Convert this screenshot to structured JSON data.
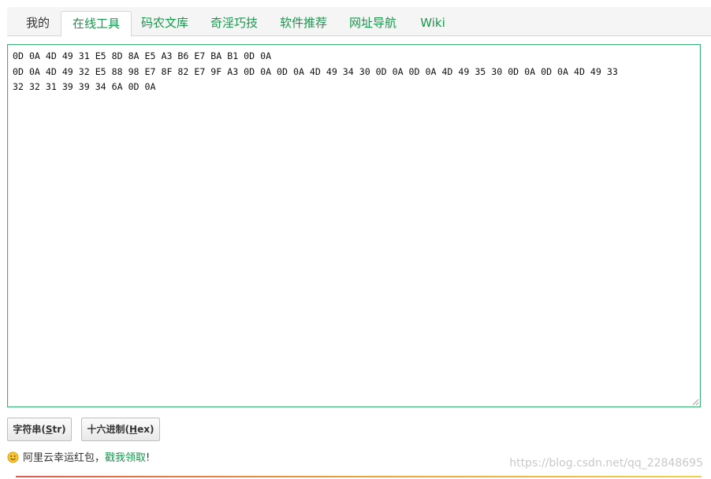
{
  "tabs": [
    {
      "label": "我的"
    },
    {
      "label": "在线工具"
    },
    {
      "label": "码农文库"
    },
    {
      "label": "奇淫巧技"
    },
    {
      "label": "软件推荐"
    },
    {
      "label": "网址导航"
    },
    {
      "label": "Wiki"
    }
  ],
  "active_tab": "在线工具",
  "editor": {
    "lines": [
      "0D 0A 4D 49 31 E5 8D 8A E5 A3 B6 E7 BA B1 0D 0A",
      "0D 0A 4D 49 32 E5 88 98 E7 8F 82 E7 9F A3 0D 0A 0D 0A 4D 49 34 30 0D 0A 0D 0A 4D 49 35 30 0D 0A 0D 0A 4D 49 33",
      "32 32 31 39 39 34 6A 0D 0A"
    ]
  },
  "buttons": {
    "str": {
      "prefix": "字符串(",
      "key": "S",
      "rest": "tr",
      "suffix": ")"
    },
    "hex": {
      "prefix": "十六进制(",
      "key": "H",
      "rest": "ex",
      "suffix": ")"
    }
  },
  "promo": {
    "icon": "smile-icon",
    "text": "阿里云幸运红包，",
    "link": "戳我领取",
    "suffix": "!"
  },
  "watermark": "https://blog.csdn.net/qq_22848695",
  "colors": {
    "accent": "#17974c",
    "editor_border": "#3db078"
  }
}
